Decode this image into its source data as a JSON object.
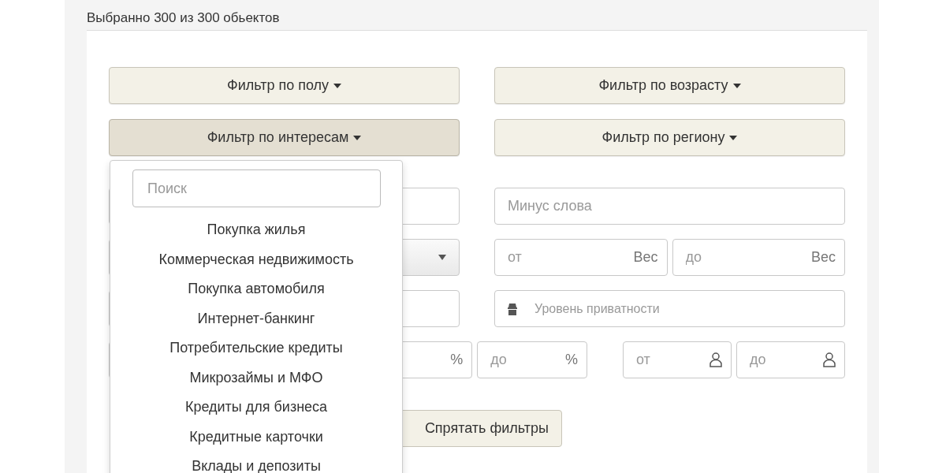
{
  "header": {
    "text": "Выбранно 300 из 300 обьектов"
  },
  "filter_buttons": [
    {
      "label": "Фильтр по полу",
      "selected": false
    },
    {
      "label": "Фильтр по возрасту",
      "selected": false
    },
    {
      "label": "Фильтр по интересам",
      "selected": true
    },
    {
      "label": "Фильтр по региону",
      "selected": false
    }
  ],
  "rows": [
    {
      "kind": "even",
      "left": [
        {
          "kind": "text"
        }
      ],
      "right": [
        {
          "kind": "text",
          "placeholder": "Минус слова"
        }
      ]
    },
    {
      "kind": "even",
      "left": [
        {
          "kind": "select"
        }
      ],
      "right": [
        {
          "kind": "text",
          "placeholder": "от",
          "suffix": "Вес"
        },
        {
          "kind": "text",
          "placeholder": "до",
          "suffix": "Вес"
        }
      ]
    },
    {
      "kind": "even",
      "left": [
        {
          "kind": "text"
        }
      ],
      "right": [
        {
          "kind": "privacy",
          "placeholder": "Уровень приватности"
        }
      ]
    },
    {
      "kind": "wide",
      "left": [
        {
          "kind": "text",
          "suffix": "%"
        },
        {
          "kind": "text",
          "placeholder": "до",
          "suffix": "%"
        }
      ],
      "right": [
        {
          "kind": "user",
          "placeholder": "от"
        },
        {
          "kind": "user",
          "placeholder": "до"
        }
      ]
    }
  ],
  "hide_button": {
    "label": "Спрятать фильтры"
  },
  "dropdown": {
    "search_placeholder": "Поиск",
    "items": [
      "Покупка жилья",
      "Коммерческая недвижимость",
      "Покупка автомобиля",
      "Интернет-банкинг",
      "Потребительские кредиты",
      "Микрозаймы и МФО",
      "Кредиты для бизнеса",
      "Кредитные карточки",
      "Вклады и депозиты"
    ]
  }
}
